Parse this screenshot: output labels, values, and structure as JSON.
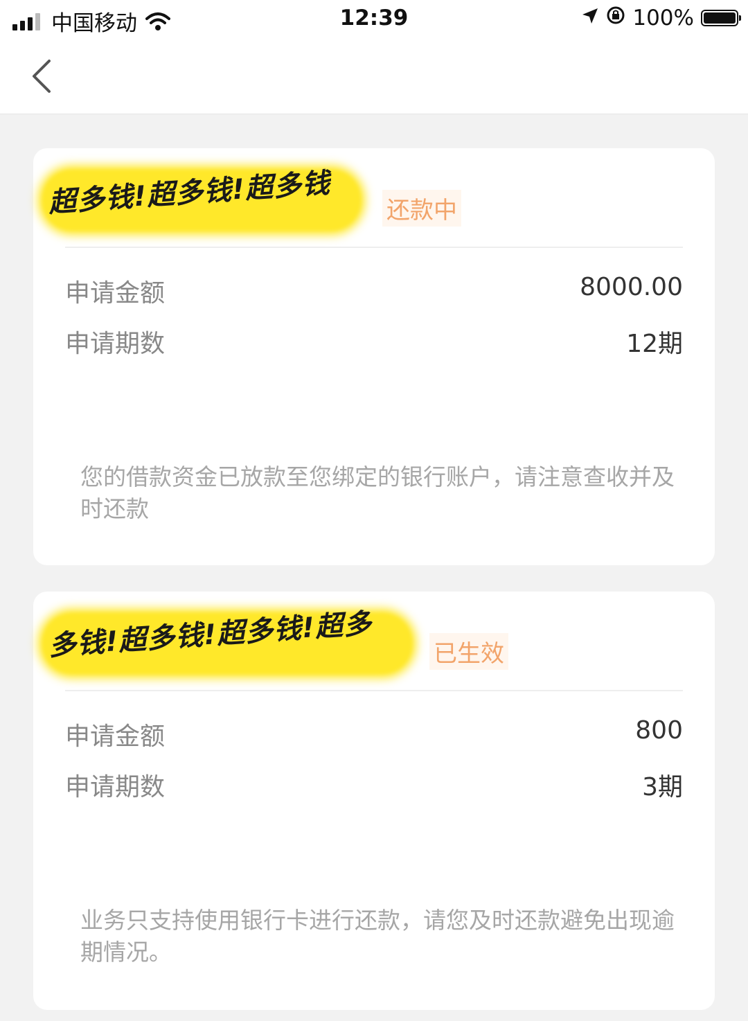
{
  "status_bar": {
    "carrier": "中国移动",
    "time": "12:39",
    "battery": "100%",
    "battery_level": 1.0
  },
  "nav": {
    "back_icon": "chevron-left-icon"
  },
  "loans": [
    {
      "name_redacted": "超多钱!超多钱!超多钱",
      "status": "还款中",
      "rows": [
        {
          "label": "申请金额",
          "value": "8000.00"
        },
        {
          "label": "申请期数",
          "value": "12期"
        }
      ],
      "note": "您的借款资金已放款至您绑定的银行账户，请注意查收并及时还款"
    },
    {
      "name_redacted": "多钱!超多钱!超多钱!超多",
      "status": "已生效",
      "rows": [
        {
          "label": "申请金额",
          "value": "800"
        },
        {
          "label": "申请期数",
          "value": "3期"
        }
      ],
      "note": "业务只支持使用银行卡进行还款，请您及时还款避免出现逾期情况。"
    }
  ],
  "colors": {
    "status_accent": "#f2a46a",
    "redaction": "#ffe82a",
    "background": "#f2f2f2"
  }
}
